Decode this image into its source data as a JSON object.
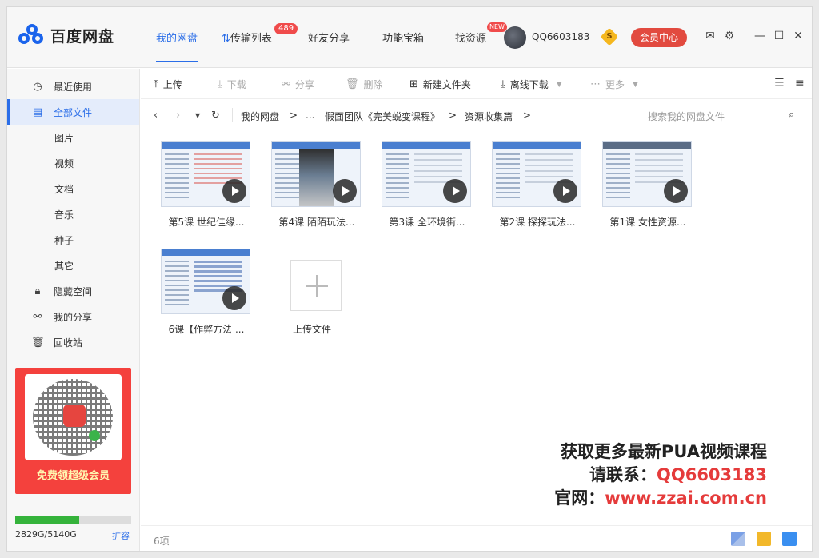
{
  "app": {
    "name": "百度网盘"
  },
  "nav": {
    "tabs": [
      {
        "label": "我的网盘"
      },
      {
        "label": "传输列表",
        "badge": "489"
      },
      {
        "label": "好友分享"
      },
      {
        "label": "功能宝箱"
      },
      {
        "label": "找资源",
        "badge": "NEW"
      }
    ]
  },
  "account": {
    "username": "QQ6603183",
    "coin_icon": "S",
    "vip_label": "会员中心"
  },
  "sidebar": {
    "items": [
      {
        "label": "最近使用",
        "icon": "clock-icon"
      },
      {
        "label": "全部文件",
        "icon": "file-icon",
        "active": true
      },
      {
        "label": "图片"
      },
      {
        "label": "视频"
      },
      {
        "label": "文档"
      },
      {
        "label": "音乐"
      },
      {
        "label": "种子"
      },
      {
        "label": "其它"
      },
      {
        "label": "隐藏空间",
        "icon": "lock-icon"
      },
      {
        "label": "我的分享",
        "icon": "share-icon"
      },
      {
        "label": "回收站",
        "icon": "trash-icon"
      }
    ],
    "promo": {
      "label": "免费领超级会员"
    },
    "quota": {
      "text": "2829G/5140G",
      "used_fraction": 0.55,
      "expand_label": "扩容"
    }
  },
  "toolbar": {
    "upload": "上传",
    "download": "下载",
    "share": "分享",
    "delete": "删除",
    "new_folder": "新建文件夹",
    "offline_download": "离线下载",
    "more": "更多"
  },
  "path": {
    "crumbs": [
      "我的网盘",
      ">",
      "...",
      "假面团队《完美蜕变课程》",
      ">",
      "资源收集篇",
      ">"
    ],
    "search_placeholder": "搜索我的网盘文件"
  },
  "files": [
    {
      "name": "第5课 世纪佳缘..."
    },
    {
      "name": "第4课 陌陌玩法..."
    },
    {
      "name": "第3课 全环境街..."
    },
    {
      "name": "第2课 探探玩法..."
    },
    {
      "name": "第1课 女性资源..."
    },
    {
      "name": "6课【作弊方法 ..."
    }
  ],
  "upload_tile": {
    "label": "上传文件"
  },
  "watermark": {
    "line1": "获取更多最新PUA视频课程",
    "line2_prefix": "请联系：",
    "line2_value": "QQ6603183",
    "line3_prefix": "官网：",
    "line3_value": "www.zzai.com.cn"
  },
  "status": {
    "count": "6项"
  },
  "colors": {
    "accent": "#2b6ee8",
    "vip": "#e24a3f",
    "quota": "#35b33b",
    "watermark_red": "#e53b3b"
  }
}
